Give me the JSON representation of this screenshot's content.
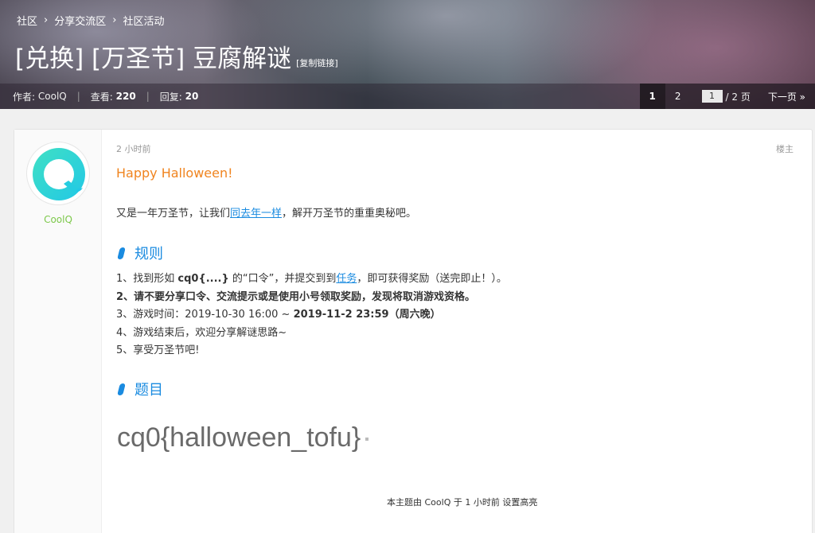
{
  "breadcrumb": [
    "社区",
    "分享交流区",
    "社区活动"
  ],
  "breadcrumb_sep": "›",
  "title": "[兑换] [万圣节] 豆腐解谜",
  "copy_link": "[复制链接]",
  "stats": {
    "author_label": "作者:",
    "author": "CoolQ",
    "views_label": "查看:",
    "views": "220",
    "replies_label": "回复:",
    "replies": "20",
    "divider": "|"
  },
  "pager": {
    "page1": "1",
    "page2": "2",
    "input_value": "1",
    "total": "/ 2 页",
    "next": "下一页 »"
  },
  "post": {
    "username": "CoolQ",
    "time": "2 小时前",
    "floor": "楼主",
    "greeting": "Happy Halloween!",
    "intro_before": "又是一年万圣节，让我们",
    "intro_link": "同去年一样",
    "intro_after": "，解开万圣节的重重奥秘吧。",
    "rules_heading": "规则",
    "rule1_a": "1、找到形如 ",
    "rule1_code": "cq0{....}",
    "rule1_b": " 的“口令”，并提交到到",
    "rule1_link": "任务",
    "rule1_c": "，即可获得奖励（送完即止！）。",
    "rule2_num": "2、",
    "rule2": "请不要分享口令、交流提示或是使用小号领取奖励，发现将取消游戏资格。",
    "rule3_a": "3、游戏时间：2019-10-30 16:00 ~ ",
    "rule3_b": "2019-11-2 23:59（周六晚）",
    "rule4": "4、游戏结束后，欢迎分享解谜思路~",
    "rule5": "5、享受万圣节吧!",
    "puzzle_heading": "题目",
    "flag": "cq0{halloween_tofu}",
    "footer": "本主题由 CoolQ 于 1 小时前 设置高亮"
  },
  "colors": {
    "accent": "#1a8be0",
    "greeting": "#f0841f",
    "username": "#7cc84a",
    "avatar_teal": "#2ad6c6"
  }
}
